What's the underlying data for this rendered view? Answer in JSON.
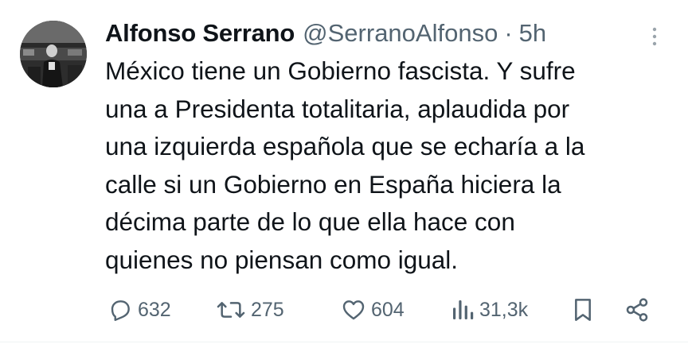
{
  "author": {
    "display_name": "Alfonso Serrano",
    "handle": "@SerranoAlfonso",
    "separator": "·",
    "time": "5h",
    "avatar": "profile-photo"
  },
  "tweet": {
    "lines": [
      "México tiene un Gobierno fascista. Y sufre",
      "una a Presidenta totalitaria, aplaudida por",
      "una izquierda española que se echaría a la",
      "calle si un Gobierno en España hiciera la",
      "décima parte de lo que ella hace con",
      "quienes no piensan como igual."
    ]
  },
  "actions": {
    "replies": "632",
    "retweets": "275",
    "likes": "604",
    "views": "31,3k"
  },
  "icons": {
    "reply": "reply-icon",
    "retweet": "retweet-icon",
    "like": "heart-icon",
    "views": "views-icon",
    "bookmark": "bookmark-icon",
    "share": "share-icon",
    "more": "more-options-icon"
  },
  "colors": {
    "text": "#0f1419",
    "secondary": "#536471",
    "background": "#ffffff"
  }
}
